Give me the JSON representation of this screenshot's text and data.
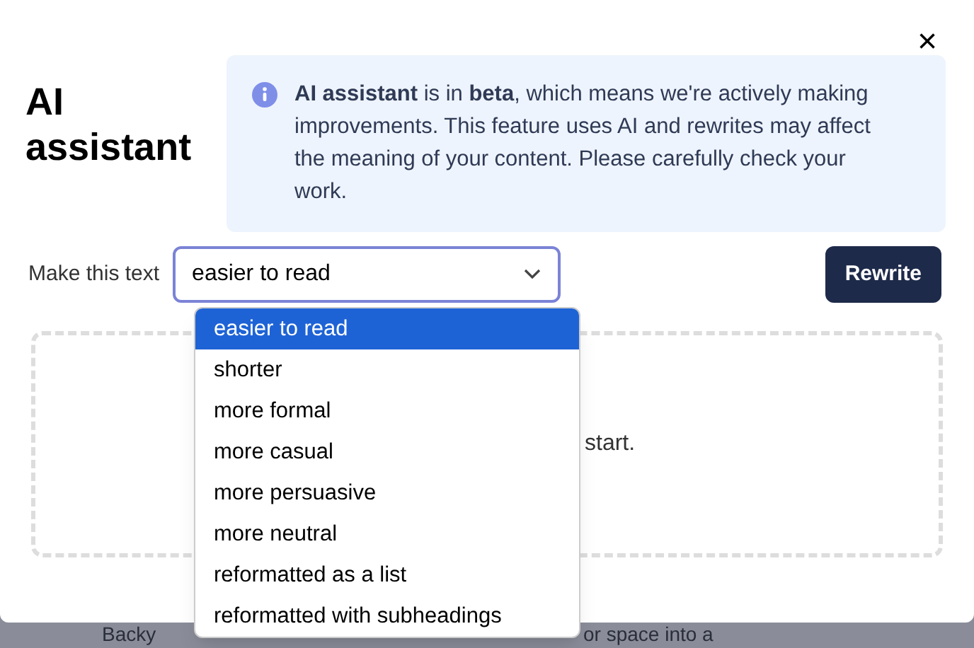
{
  "dialog": {
    "title": "AI assistant",
    "close": "×",
    "notice": "**AI assistant** is in **beta**, which means we're actively making improvements. This feature uses AI and rewrites may affect the meaning of your content. Please carefully check your work.",
    "select_label": "Make this text",
    "select_value": "easier to read",
    "button": "Rewrite",
    "empty_message": "start."
  },
  "dropdown": {
    "options": [
      {
        "label": "easier to read",
        "selected": true
      },
      {
        "label": "shorter",
        "selected": false
      },
      {
        "label": "more formal",
        "selected": false
      },
      {
        "label": "more casual",
        "selected": false
      },
      {
        "label": "more persuasive",
        "selected": false
      },
      {
        "label": "more neutral",
        "selected": false
      },
      {
        "label": "reformatted as a list",
        "selected": false
      },
      {
        "label": "reformatted with subheadings",
        "selected": false
      }
    ]
  },
  "background": {
    "texts": [
      "Backy",
      "or space into a"
    ]
  }
}
